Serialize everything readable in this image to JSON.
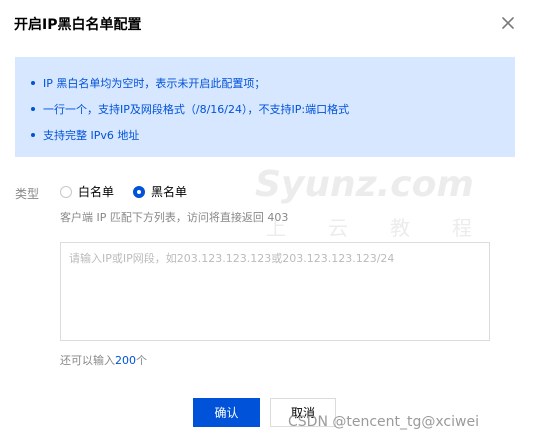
{
  "dialog": {
    "title": "开启IP黑白名单配置",
    "close_icon": "close-icon"
  },
  "notice": {
    "items": [
      "IP 黑白名单均为空时，表示未开启此配置项；",
      "一行一个，支持IP及网段格式（/8/16/24），不支持IP:端口格式",
      "支持完整 IPv6 地址"
    ]
  },
  "type_field": {
    "label": "类型",
    "options": [
      {
        "label": "白名单",
        "checked": false
      },
      {
        "label": "黑名单",
        "checked": true
      }
    ],
    "hint": "客户端 IP 匹配下方列表，访问将直接返回 403"
  },
  "ip_input": {
    "value": "",
    "placeholder": "请输入IP或IP网段，如203.123.123.123或203.123.123.123/24"
  },
  "counter": {
    "prefix": "还可以输入",
    "remaining": "200",
    "suffix": "个"
  },
  "buttons": {
    "confirm": "确认",
    "cancel": "取消"
  },
  "watermarks": {
    "site": "Syunz.com",
    "site_subtitle": "上云教程",
    "csdn": "CSDN @tencent_tg@xciwei"
  },
  "colors": {
    "accent": "#0052d9",
    "notice_bg": "#d6e7ff"
  }
}
